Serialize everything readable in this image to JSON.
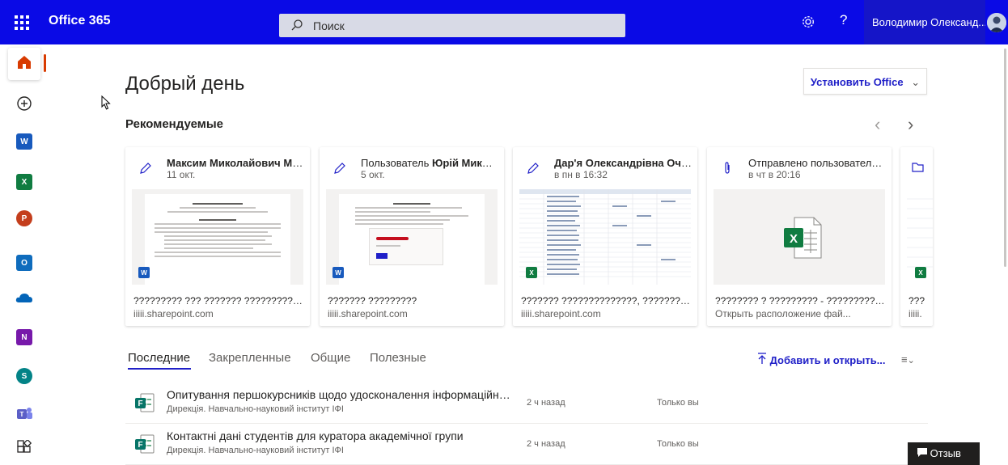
{
  "topbar": {
    "app_name": "Office 365",
    "search_placeholder": "Поиск",
    "help_label": "?",
    "user_name": "Володимир Олександ..."
  },
  "rail": {
    "items": [
      "home",
      "create",
      "word",
      "excel",
      "powerpoint",
      "outlook",
      "onedrive",
      "onenote",
      "sharepoint",
      "teams",
      "all-apps"
    ],
    "icon_letters": {
      "word": "W",
      "excel": "X",
      "powerpoint": "P",
      "outlook": "O",
      "onenote": "N",
      "sharepoint": "S"
    },
    "colors": {
      "word": "#185abd",
      "excel": "#107c41",
      "powerpoint": "#c43e1c",
      "outlook": "#0f6cbd",
      "onedrive": "#0364b8",
      "onenote": "#7719aa",
      "sharepoint": "#038387",
      "teams": "#5b5fc7"
    }
  },
  "greeting": "Добрый день",
  "install_button": "Установить Office",
  "recommended": {
    "heading": "Рекомендуемые",
    "cards": [
      {
        "icon": "pencil-icon",
        "title_prefix": "",
        "title_bold": "Максим Миколайович Маль...",
        "subtitle": "11 окт.",
        "thumb_type": "word",
        "name": "????????? ??? ??????? ????????????...",
        "location": "iiiii.sharepoint.com"
      },
      {
        "icon": "pencil-icon",
        "title_prefix": "Пользователь ",
        "title_bold": "Юрій Микола...",
        "subtitle": "5 окт.",
        "thumb_type": "word",
        "name": "??????? ?????????",
        "location": "iiiii.sharepoint.com"
      },
      {
        "icon": "pencil-icon",
        "title_prefix": "",
        "title_bold": "Дар'я Олександрівна Очитко...",
        "subtitle": "в пн в 16:32",
        "thumb_type": "excel",
        "name": "??????? ??????????????, ??????? ??? ...",
        "location": "iiiii.sharepoint.com"
      },
      {
        "icon": "paperclip-icon",
        "title_prefix": "Отправлено пользователем ...",
        "title_bold": "",
        "subtitle": "в чт в 20:16",
        "thumb_type": "excel-file",
        "name": "???????? ? ????????? - ???????????...",
        "location": "Открыть расположение фай..."
      },
      {
        "icon": "folder-icon",
        "title_prefix": "",
        "title_bold": "",
        "subtitle": "",
        "thumb_type": "excel",
        "name": "???",
        "location": "iiiii."
      }
    ]
  },
  "tabs": [
    {
      "label": "Последние",
      "active": true
    },
    {
      "label": "Закрепленные",
      "active": false
    },
    {
      "label": "Общие",
      "active": false
    },
    {
      "label": "Полезные",
      "active": false
    }
  ],
  "add_open_label": "Добавить и открыть...",
  "sort_menu_label": "≡",
  "files": [
    {
      "name": "Опитування першокурсників щодо удосконалення інформаційної ст...",
      "path": "Дирекція. Навчально-науковий інститут ІФІ",
      "time": "2 ч назад",
      "sharing": "Только вы"
    },
    {
      "name": "Контактні дані студентів для куратора академічної групи",
      "path": "Дирекція. Навчально-науковий інститут ІФІ",
      "time": "2 ч назад",
      "sharing": "Только вы"
    }
  ],
  "feedback_label": "Отзыв"
}
